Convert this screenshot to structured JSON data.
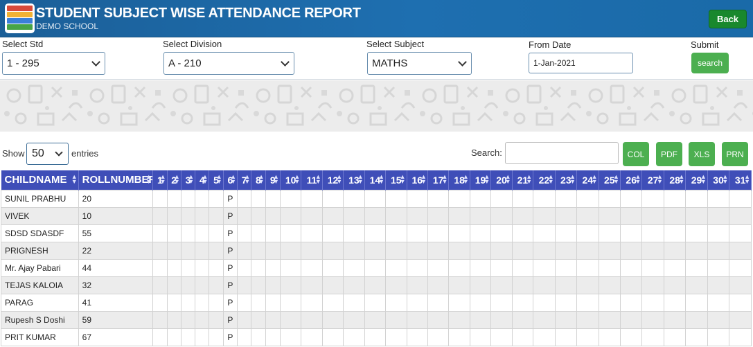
{
  "header": {
    "title": "STUDENT SUBJECT WISE ATTENDANCE REPORT",
    "subtitle": "DEMO SCHOOL",
    "back_label": "Back"
  },
  "filters": {
    "std": {
      "label": "Select Std",
      "value": "1 - 295"
    },
    "division": {
      "label": "Select Division",
      "value": "A - 210"
    },
    "subject": {
      "label": "Select Subject",
      "value": "MATHS"
    },
    "from_date": {
      "label": "From Date",
      "value": "1-Jan-2021"
    },
    "submit": {
      "label": "Submit",
      "button": "search"
    }
  },
  "table_controls": {
    "show_label": "Show",
    "entries_value": "50",
    "entries_label": "entries",
    "search_label": "Search:",
    "buttons": [
      "COL",
      "PDF",
      "XLS",
      "PRN"
    ]
  },
  "table": {
    "col_name": "CHILDNAME",
    "col_roll": "ROLLNUMBER",
    "days": [
      "1",
      "2",
      "3",
      "4",
      "5",
      "6",
      "7",
      "8",
      "9",
      "10",
      "11",
      "12",
      "13",
      "14",
      "15",
      "16",
      "17",
      "18",
      "19",
      "20",
      "21",
      "22",
      "23",
      "24",
      "25",
      "26",
      "27",
      "28",
      "29",
      "30",
      "31"
    ],
    "rows": [
      {
        "name": "SUNIL PRABHU",
        "roll": "20",
        "day6": "P"
      },
      {
        "name": "VIVEK",
        "roll": "10",
        "day6": "P"
      },
      {
        "name": "SDSD SDASDF",
        "roll": "55",
        "day6": "P"
      },
      {
        "name": "PRIGNESH",
        "roll": "22",
        "day6": "P"
      },
      {
        "name": "Mr. Ajay Pabari",
        "roll": "44",
        "day6": "P"
      },
      {
        "name": "TEJAS KALOIA",
        "roll": "32",
        "day6": "P"
      },
      {
        "name": "PARAG",
        "roll": "41",
        "day6": "P"
      },
      {
        "name": "Rupesh S Doshi",
        "roll": "59",
        "day6": "P"
      },
      {
        "name": "PRIT KUMAR",
        "roll": "67",
        "day6": "P"
      }
    ]
  }
}
